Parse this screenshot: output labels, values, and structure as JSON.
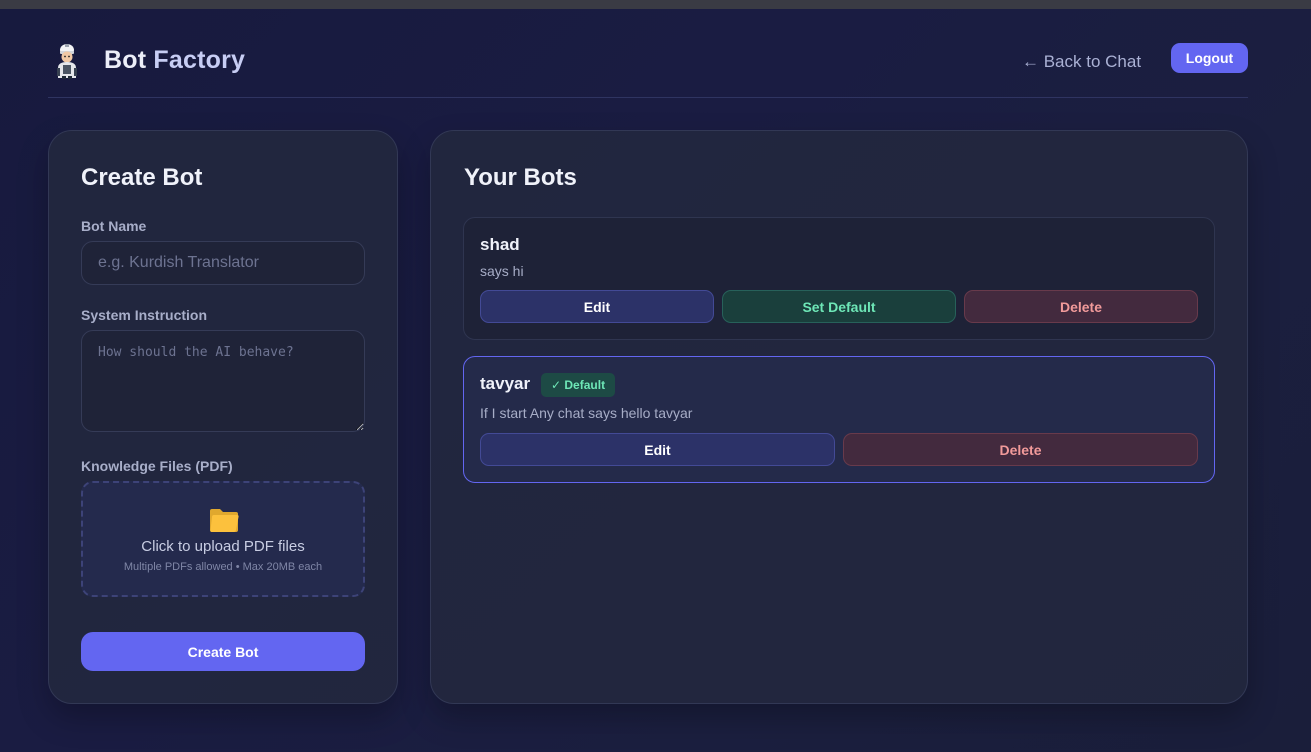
{
  "header": {
    "title_part1": "Bot",
    "title_part2": "Factory",
    "back_link": "← Back to Chat",
    "logout_label": "Logout",
    "logo_icon": "bot-mascot-icon"
  },
  "create_panel": {
    "title": "Create Bot",
    "name_label": "Bot Name",
    "name_value": "",
    "name_placeholder": "e.g. Kurdish Translator",
    "instruction_label": "System Instruction",
    "instruction_value": "",
    "instruction_placeholder": "How should the AI behave?",
    "files_label": "Knowledge Files (PDF)",
    "upload_icon": "folder-icon",
    "upload_main": "Click to upload PDF files",
    "upload_sub": "Multiple PDFs allowed • Max 20MB each",
    "create_button": "Create Bot"
  },
  "bots_panel": {
    "title": "Your Bots",
    "bots": [
      {
        "name": "shad",
        "description": "says hi",
        "is_default": false,
        "edit_label": "Edit",
        "set_default_label": "Set Default",
        "delete_label": "Delete"
      },
      {
        "name": "tavyar",
        "description": "If I start Any chat says hello tavyar",
        "is_default": true,
        "badge": "✓ Default",
        "edit_label": "Edit",
        "delete_label": "Delete"
      }
    ]
  },
  "colors": {
    "accent": "#6366f1",
    "success": "#6ee7b7",
    "danger": "#f19a9a",
    "background": "#171a3e"
  }
}
